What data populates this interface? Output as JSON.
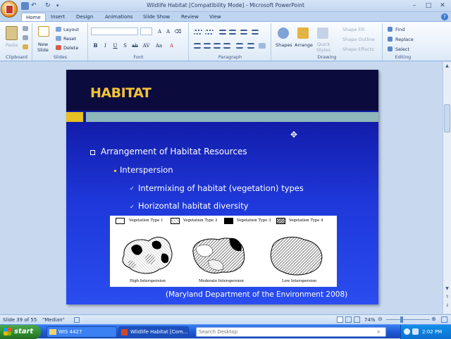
{
  "window": {
    "title": "Wildlife Habitat [Compatibility Mode] - Microsoft PowerPoint"
  },
  "tabs": [
    "Home",
    "Insert",
    "Design",
    "Animations",
    "Slide Show",
    "Review",
    "View"
  ],
  "ribbon": {
    "clipboard": {
      "label": "Clipboard",
      "paste": "Paste"
    },
    "slides": {
      "label": "Slides",
      "new_slide": "New",
      "new_slide2": "Slide",
      "layout": "Layout",
      "reset": "Reset",
      "delete": "Delete"
    },
    "font": {
      "label": "Font"
    },
    "paragraph": {
      "label": "Paragraph"
    },
    "drawing": {
      "label": "Drawing",
      "shapes": "Shapes",
      "arrange": "Arrange",
      "quick_styles": "Quick",
      "quick_styles2": "Styles",
      "shape_fill": "Shape Fill",
      "shape_outline": "Shape Outline",
      "shape_effects": "Shape Effects"
    },
    "editing": {
      "label": "Editing",
      "find": "Find",
      "replace": "Replace",
      "select": "Select"
    }
  },
  "slide": {
    "title": "HABITAT",
    "bullet1": "Arrangement of Habitat Resources",
    "bullet2": "Interspersion",
    "bullet3": "Intermixing of habitat (vegetation) types",
    "bullet4": "Horizontal habitat diversity",
    "legend": [
      "Vegetation Type 1",
      "Vegetation Type 2",
      "Vegetation Type 3",
      "Vegetation Type 4"
    ],
    "captions": [
      "High Interspersion",
      "Moderate Interspersion",
      "Low Interspersion"
    ],
    "citation": "(Maryland Department of the Environment 2008)"
  },
  "status": {
    "slide_info": "Slide 39 of 55",
    "theme": "\"Median\"",
    "zoom": "74%"
  },
  "taskbar": {
    "start": "start",
    "items": [
      "WIS 4427",
      "Wildlife Habitat [Com..."
    ],
    "search_placeholder": "Search Desktop",
    "clock": "2:02 PM"
  },
  "colors": {
    "title": "#f2c23a",
    "slide_bg": "#1e37d8",
    "accent_yellow": "#e7c021",
    "accent_teal": "#8eb6bb"
  }
}
